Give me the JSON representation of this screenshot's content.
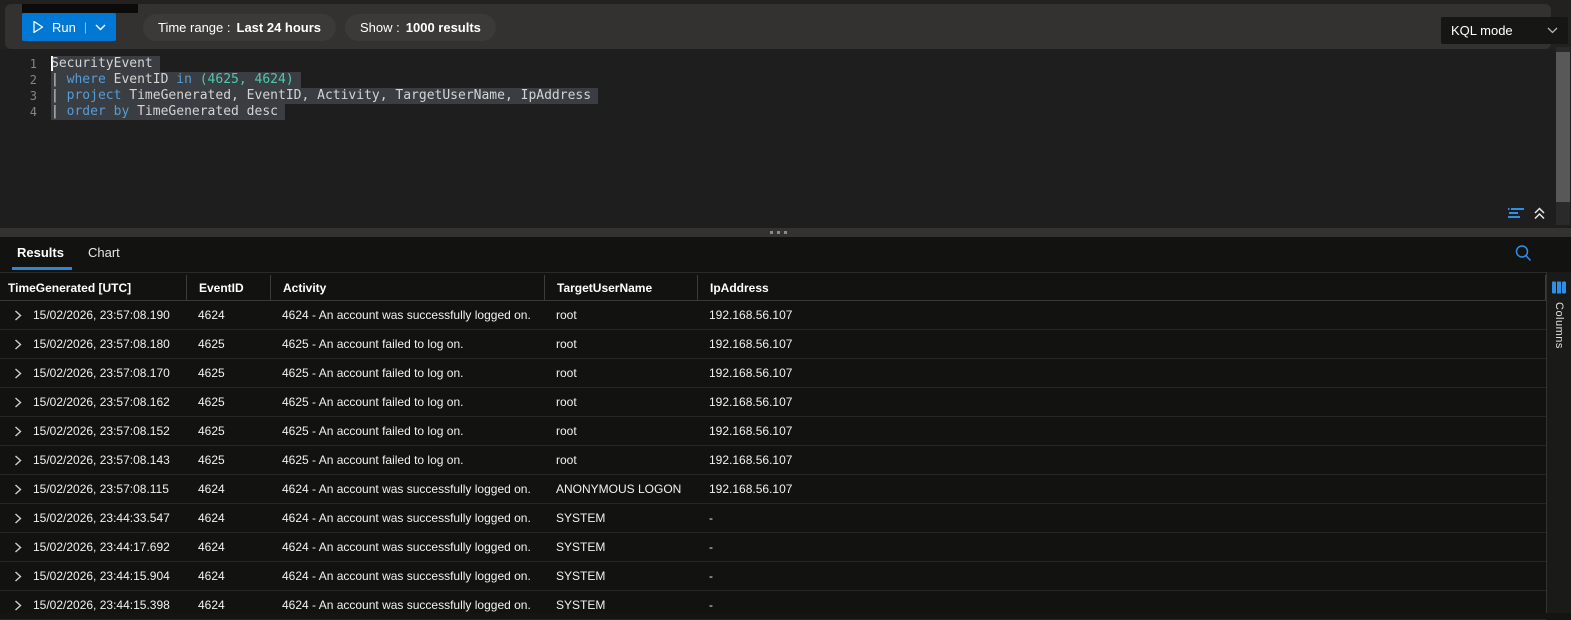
{
  "toolbar": {
    "run_label": "Run",
    "time_range_label": "Time range :",
    "time_range_value": "Last 24 hours",
    "show_label": "Show :",
    "show_value": "1000 results",
    "kql_mode_label": "KQL mode"
  },
  "editor": {
    "lines": [
      {
        "num": "1",
        "selected": true,
        "cursor": true,
        "tokens": [
          {
            "text": "SecurityEvent",
            "type": "plain"
          }
        ]
      },
      {
        "num": "2",
        "selected": true,
        "tokens": [
          {
            "text": "| ",
            "type": "plain"
          },
          {
            "text": "where",
            "type": "keyword"
          },
          {
            "text": " EventID ",
            "type": "plain"
          },
          {
            "text": "in",
            "type": "keyword"
          },
          {
            "text": " ",
            "type": "plain"
          },
          {
            "text": "(4625, 4624)",
            "type": "number"
          }
        ]
      },
      {
        "num": "3",
        "selected": true,
        "tokens": [
          {
            "text": "| ",
            "type": "plain"
          },
          {
            "text": "project",
            "type": "keyword"
          },
          {
            "text": " TimeGenerated, EventID, Activity, TargetUserName, IpAddress",
            "type": "plain"
          }
        ]
      },
      {
        "num": "4",
        "selected": true,
        "tokens": [
          {
            "text": "| ",
            "type": "plain"
          },
          {
            "text": "order",
            "type": "keyword"
          },
          {
            "text": " ",
            "type": "plain"
          },
          {
            "text": "by",
            "type": "keyword"
          },
          {
            "text": " TimeGenerated desc",
            "type": "plain"
          }
        ]
      }
    ]
  },
  "results": {
    "tabs": [
      {
        "label": "Results"
      },
      {
        "label": "Chart"
      }
    ],
    "columns_panel_label": "Columns",
    "table": {
      "headers": [
        "TimeGenerated [UTC]",
        "EventID",
        "Activity",
        "TargetUserName",
        "IpAddress"
      ],
      "rows": [
        [
          "15/02/2026, 23:57:08.190",
          "4624",
          "4624 - An account was successfully logged on.",
          "root",
          "192.168.56.107"
        ],
        [
          "15/02/2026, 23:57:08.180",
          "4625",
          "4625 - An account failed to log on.",
          "root",
          "192.168.56.107"
        ],
        [
          "15/02/2026, 23:57:08.170",
          "4625",
          "4625 - An account failed to log on.",
          "root",
          "192.168.56.107"
        ],
        [
          "15/02/2026, 23:57:08.162",
          "4625",
          "4625 - An account failed to log on.",
          "root",
          "192.168.56.107"
        ],
        [
          "15/02/2026, 23:57:08.152",
          "4625",
          "4625 - An account failed to log on.",
          "root",
          "192.168.56.107"
        ],
        [
          "15/02/2026, 23:57:08.143",
          "4625",
          "4625 - An account failed to log on.",
          "root",
          "192.168.56.107"
        ],
        [
          "15/02/2026, 23:57:08.115",
          "4624",
          "4624 - An account was successfully logged on.",
          "ANONYMOUS LOGON",
          "192.168.56.107"
        ],
        [
          "15/02/2026, 23:44:33.547",
          "4624",
          "4624 - An account was successfully logged on.",
          "SYSTEM",
          "-"
        ],
        [
          "15/02/2026, 23:44:17.692",
          "4624",
          "4624 - An account was successfully logged on.",
          "SYSTEM",
          "-"
        ],
        [
          "15/02/2026, 23:44:15.904",
          "4624",
          "4624 - An account was successfully logged on.",
          "SYSTEM",
          "-"
        ],
        [
          "15/02/2026, 23:44:15.398",
          "4624",
          "4624 - An account was successfully logged on.",
          "SYSTEM",
          "-"
        ]
      ]
    }
  },
  "colors": {
    "accent_blue": "#0078d4",
    "tab_underline": "#2b88d8",
    "icon_blue": "#2f8fe8",
    "keyword": "#569cd6",
    "number": "#4ec9b0",
    "code_plain": "#d4d4d4",
    "selection": "#3a3d41",
    "toolbar_bg": "#333231",
    "editor_bg": "#1e1e1e",
    "results_bg": "#121211"
  }
}
